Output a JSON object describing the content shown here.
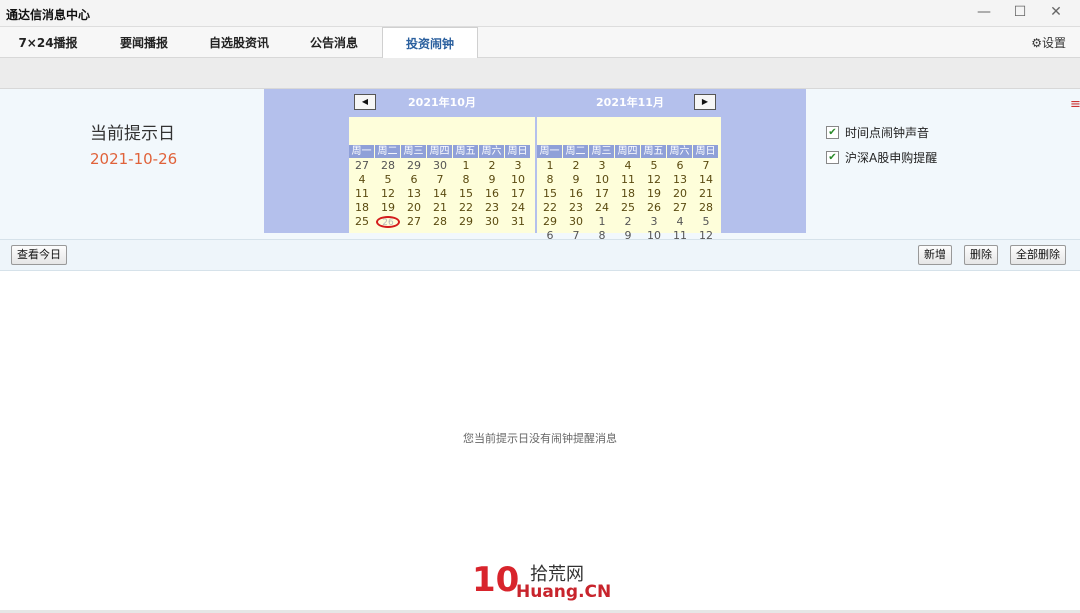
{
  "window": {
    "title": "通达信消息中心",
    "minimize": "—",
    "maximize": "☐",
    "close": "✕"
  },
  "tabs": [
    {
      "label": "7×24播报"
    },
    {
      "label": "要闻播报"
    },
    {
      "label": "自选股资讯"
    },
    {
      "label": "公告消息"
    },
    {
      "label": "投资闹钟"
    }
  ],
  "settings": {
    "label": "设置",
    "icon": "gear-icon"
  },
  "reminder": {
    "label": "当前提示日",
    "date": "2021-10-26"
  },
  "calendar": {
    "prev_icon": "◀",
    "next_icon": "▶",
    "weekdays": [
      "周一",
      "周二",
      "周三",
      "周四",
      "周五",
      "周六",
      "周日"
    ],
    "months": [
      {
        "title": "2021年10月",
        "days": [
          "27",
          "28",
          "29",
          "30",
          "1",
          "2",
          "3",
          "4",
          "5",
          "6",
          "7",
          "8",
          "9",
          "10",
          "11",
          "12",
          "13",
          "14",
          "15",
          "16",
          "17",
          "18",
          "19",
          "20",
          "21",
          "22",
          "23",
          "24",
          "25",
          "26",
          "27",
          "28",
          "29",
          "30",
          "31"
        ],
        "selected": "26"
      },
      {
        "title": "2021年11月",
        "days": [
          "1",
          "2",
          "3",
          "4",
          "5",
          "6",
          "7",
          "8",
          "9",
          "10",
          "11",
          "12",
          "13",
          "14",
          "15",
          "16",
          "17",
          "18",
          "19",
          "20",
          "21",
          "22",
          "23",
          "24",
          "25",
          "26",
          "27",
          "28",
          "29",
          "30",
          "1",
          "2",
          "3",
          "4",
          "5",
          "6",
          "7",
          "8",
          "9",
          "10",
          "11",
          "12"
        ]
      }
    ]
  },
  "options": [
    {
      "label": "时间点闹钟声音",
      "checked": true
    },
    {
      "label": "沪深A股申购提醒",
      "checked": true
    }
  ],
  "actions": {
    "view_today": "查看今日",
    "add": "新增",
    "delete": "删除",
    "delete_all": "全部删除"
  },
  "empty_message": "您当前提示日没有闹钟提醒消息",
  "watermark": {
    "big": "10",
    "cn": "拾荒网",
    "en": "Huang.CN"
  },
  "colors": {
    "accent": "#2a5f9e",
    "date": "#e0623a",
    "calendar_bg": "#b4c0ec",
    "month_bg": "#fefeda"
  }
}
